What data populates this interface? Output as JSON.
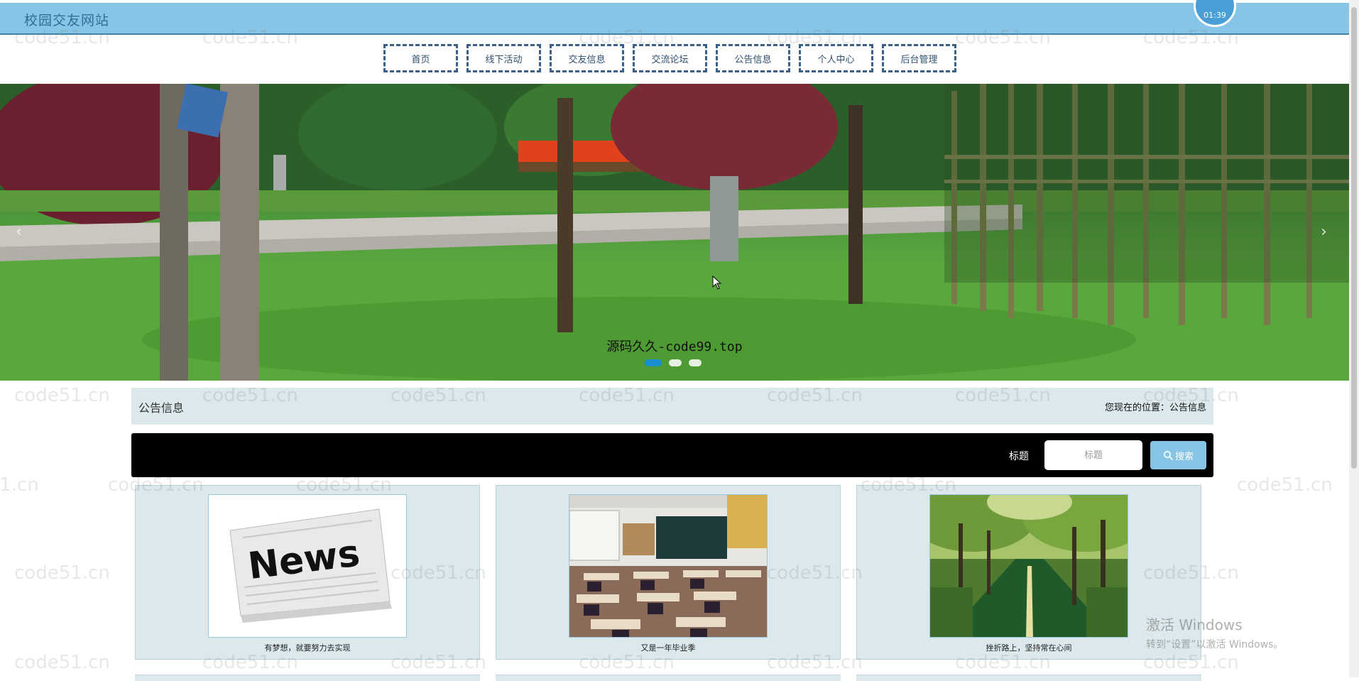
{
  "header": {
    "site_title": "校园交友网站",
    "clock": "01:39"
  },
  "nav": {
    "items": [
      {
        "label": "首页"
      },
      {
        "label": "线下活动"
      },
      {
        "label": "交友信息"
      },
      {
        "label": "交流论坛"
      },
      {
        "label": "公告信息"
      },
      {
        "label": "个人中心"
      },
      {
        "label": "后台管理"
      }
    ]
  },
  "banner": {
    "caption": "源码久久-code99.top",
    "slide_count": 3,
    "active_slide": 1
  },
  "breadcrumb": {
    "title": "公告信息",
    "location_prefix": "您现在的位置：",
    "location": "公告信息"
  },
  "search": {
    "label": "标题",
    "placeholder": "标题",
    "button_label": "搜索"
  },
  "cards": [
    {
      "title": "有梦想，就要努力去实现",
      "image": "newspaper"
    },
    {
      "title": "又是一年毕业季",
      "image": "classroom"
    },
    {
      "title": "挫折路上，坚持常在心间",
      "image": "tree-lined-road"
    }
  ],
  "watermark": "code51.cn",
  "os_overlay": {
    "activate_title": "激活 Windows",
    "activate_sub": "转到“设置”以激活 Windows。"
  },
  "colors": {
    "header_bg": "#86c5e6",
    "nav_border": "#3b5f86",
    "panel_bg": "#dbe8ec",
    "search_bar_bg": "#000000",
    "search_button_bg": "#86c5e6"
  }
}
